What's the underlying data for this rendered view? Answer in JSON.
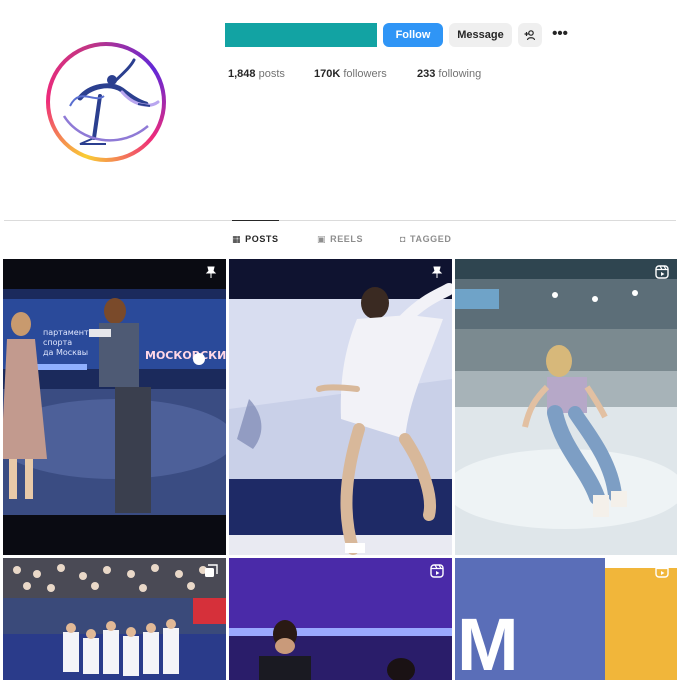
{
  "profile": {
    "follow_label": "Follow",
    "message_label": "Message",
    "suggest_icon": "add-person-icon",
    "more_label": "•••",
    "stats": {
      "posts_count": "1,848",
      "posts_label": "posts",
      "followers_count": "170K",
      "followers_label": "followers",
      "following_count": "233",
      "following_label": "following"
    }
  },
  "tabs": [
    {
      "label": "POSTS",
      "icon": "grid-icon",
      "active": true
    },
    {
      "label": "REELS",
      "icon": "reels-icon",
      "active": false
    },
    {
      "label": "TAGGED",
      "icon": "tagged-icon",
      "active": false
    }
  ],
  "grid": {
    "posts": [
      {
        "scene": "pair-skaters-on-ice",
        "badge": "pin-icon",
        "banner_line1": "партамент",
        "banner_line2": "спорта",
        "banner_line3": "да Москвы",
        "banner_big": "МОСКОВСКИЙ СПОРТ"
      },
      {
        "scene": "skater-white-dress",
        "badge": "pin-icon"
      },
      {
        "scene": "skater-jeans-rink",
        "badge": "reel-icon"
      },
      {
        "scene": "audience-stands",
        "badge": "carousel-icon"
      },
      {
        "scene": "skaters-purple-arena",
        "badge": "reel-icon"
      },
      {
        "scene": "rink-board-letter",
        "badge": "reel-icon",
        "board_letter": "M"
      }
    ]
  },
  "colors": {
    "username_bar": "#12a3a3",
    "follow_button": "#2f95f6",
    "secondary_button": "#efefef"
  }
}
